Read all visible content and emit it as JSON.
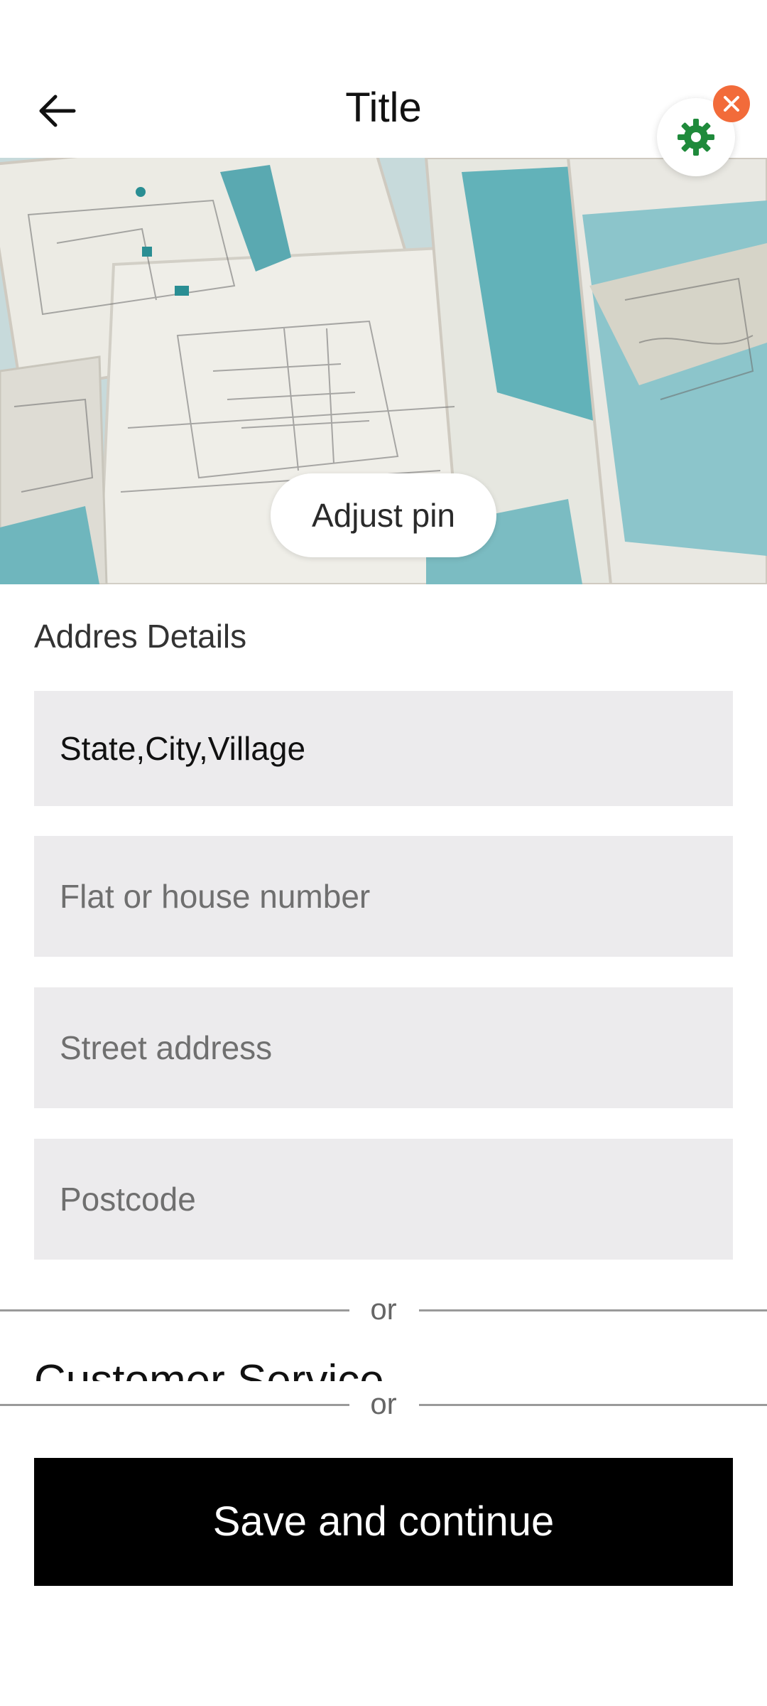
{
  "header": {
    "title": "Title",
    "back_icon": "arrow-left-icon",
    "settings_icon": "gear-icon",
    "close_icon": "close-icon",
    "settings_color": "#1f8a3b",
    "close_color": "#f26b3a"
  },
  "map": {
    "adjust_pin_label": "Adjust pin"
  },
  "form": {
    "section_label": "Addres Details",
    "fields": [
      {
        "value": "State,City,Village",
        "placeholder": ""
      },
      {
        "value": "",
        "placeholder": "Flat or house number"
      },
      {
        "value": "",
        "placeholder": "Street address"
      },
      {
        "value": "",
        "placeholder": "Postcode"
      }
    ]
  },
  "dividers": [
    "or",
    "or"
  ],
  "customer_service": "Customer Service",
  "actions": {
    "save_label": "Save and continue"
  }
}
